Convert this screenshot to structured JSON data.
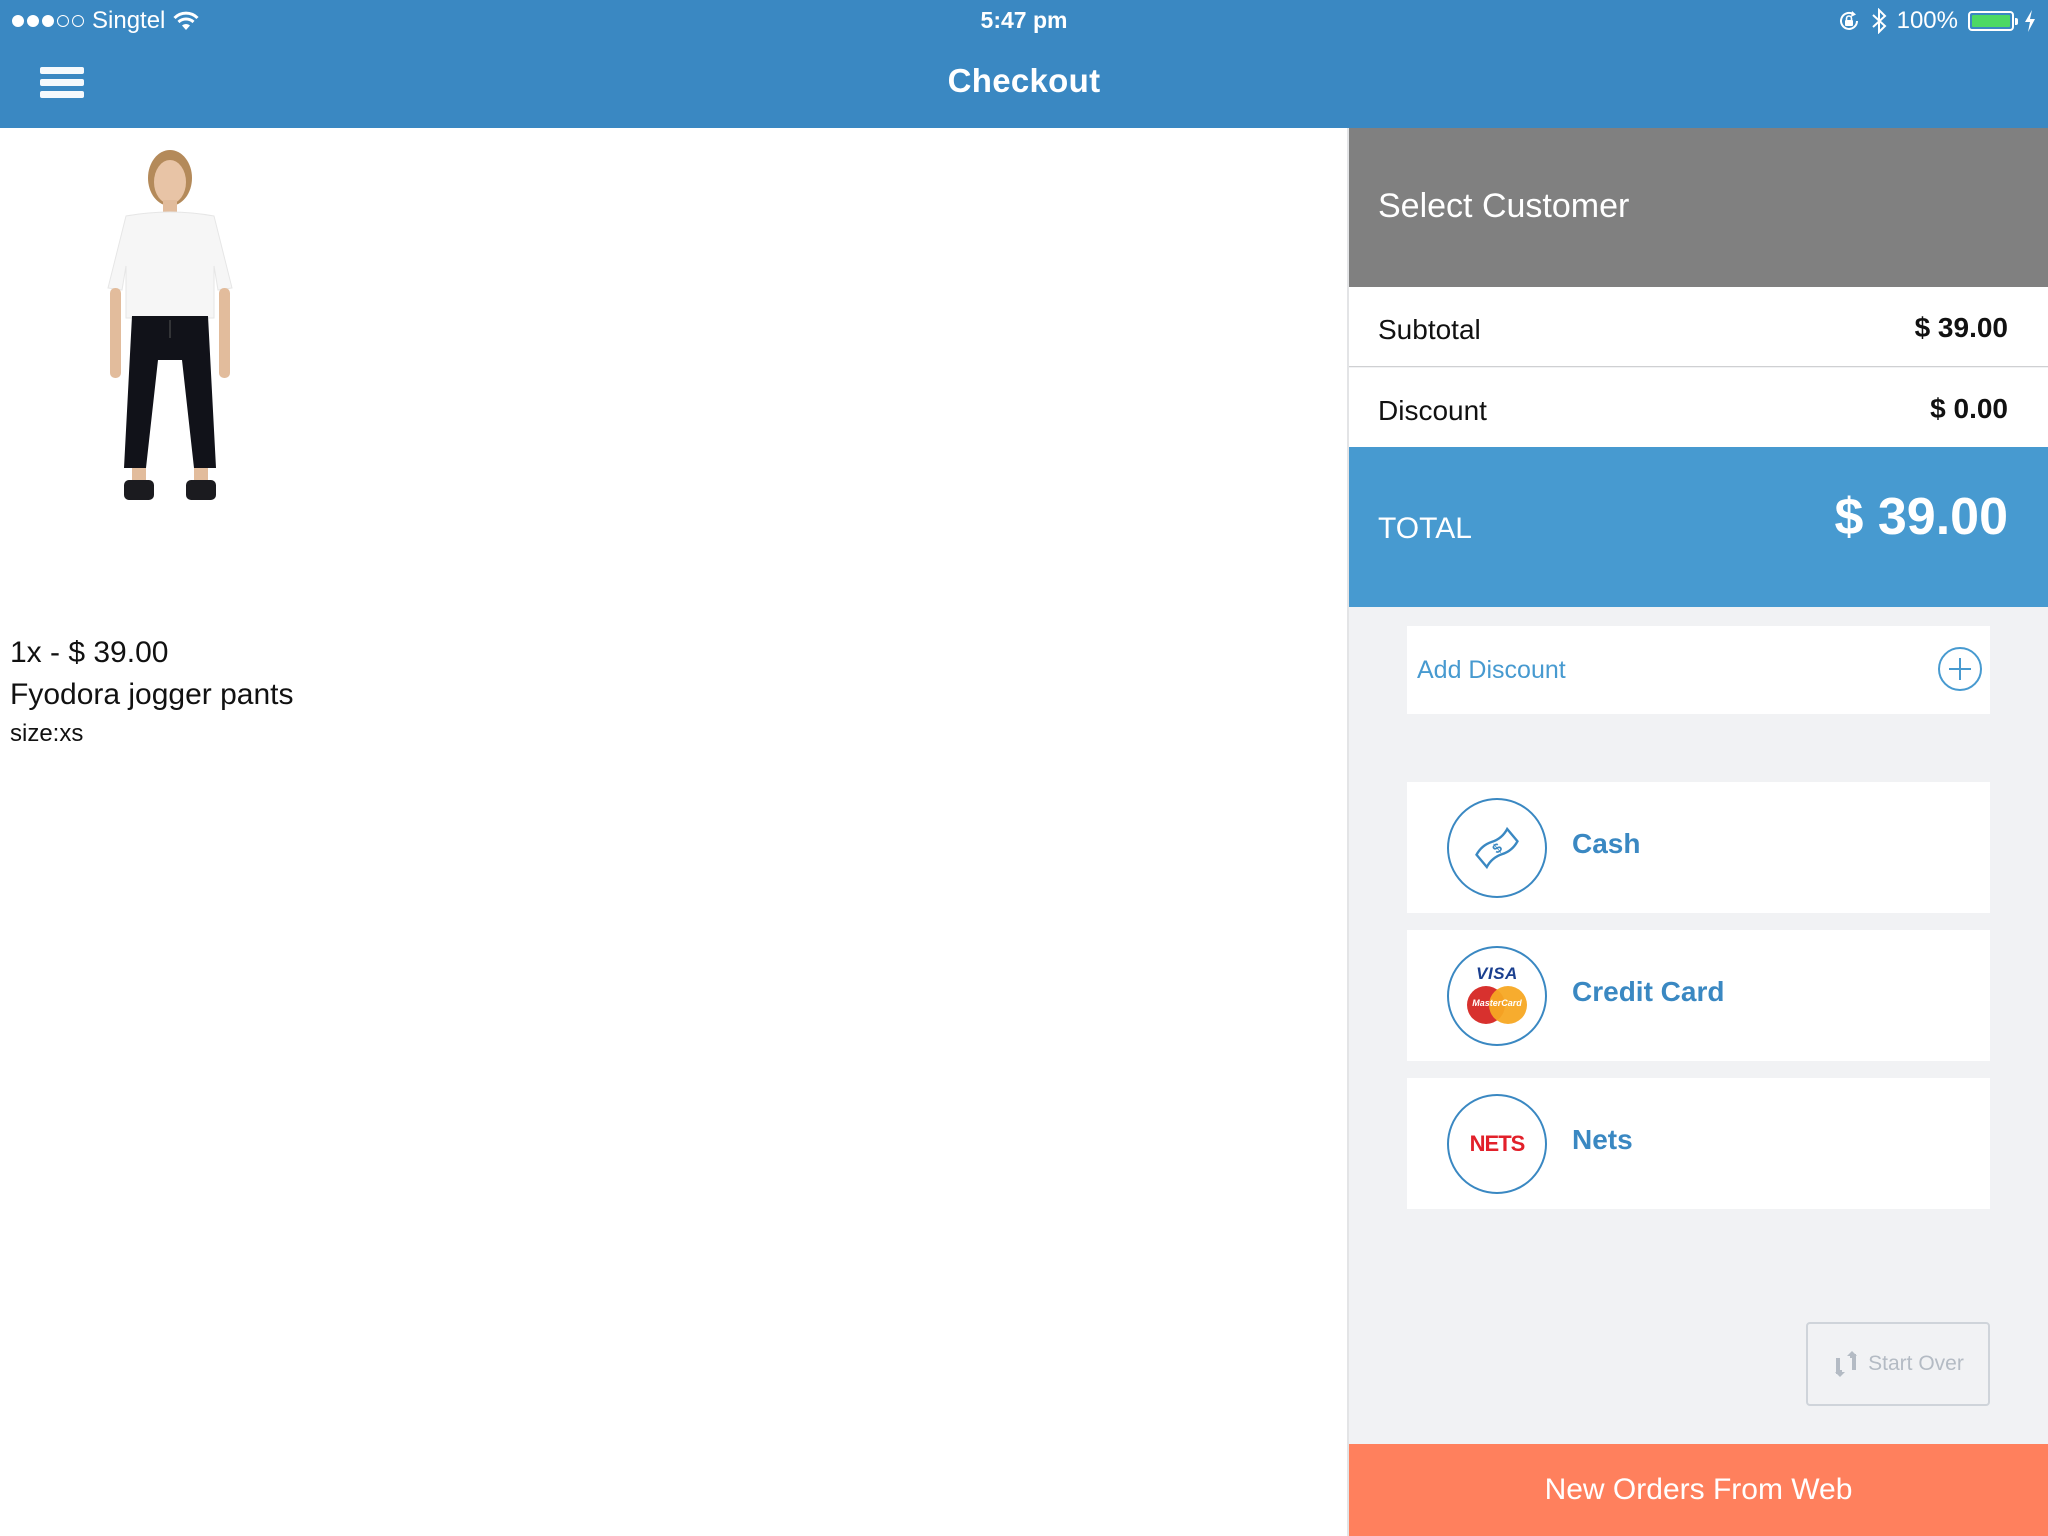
{
  "status_bar": {
    "signal_dots_filled": 3,
    "signal_dots_total": 5,
    "carrier": "Singtel",
    "time": "5:47 pm",
    "battery_percent": "100%",
    "icons": [
      "wifi-icon",
      "rotation-lock-icon",
      "bluetooth-icon",
      "battery-icon",
      "charging-bolt-icon"
    ],
    "battery_color": "#4cd964"
  },
  "navbar": {
    "title": "Checkout",
    "menu_icon": "hamburger-menu-icon",
    "color": "#3a88c2"
  },
  "cart": {
    "items": [
      {
        "quantity_price": "1x - $ 39.00",
        "name": "Fyodora jogger pants",
        "variant": "size:xs",
        "image": "model wearing white t-shirt and black jogger pants"
      }
    ]
  },
  "summary": {
    "select_customer": "Select Customer",
    "subtotal_label": "Subtotal",
    "subtotal_value": "$ 39.00",
    "discount_label": "Discount",
    "discount_value": "$ 0.00",
    "total_label": "TOTAL",
    "total_value": "$ 39.00",
    "total_color": "#479ad0"
  },
  "actions": {
    "add_discount": "Add Discount",
    "payment_methods": [
      {
        "label": "Cash",
        "icon": "cash-banknote-icon"
      },
      {
        "label": "Credit Card",
        "icon": "visa-mastercard-icon"
      },
      {
        "label": "Nets",
        "icon": "nets-logo-icon"
      }
    ],
    "start_over": "Start Over",
    "new_orders": "New Orders From Web",
    "new_orders_color": "#ff805d"
  },
  "logos": {
    "visa": "VISA",
    "mastercard": "MasterCard",
    "nets_n": "N",
    "nets_rest": "ETS"
  }
}
